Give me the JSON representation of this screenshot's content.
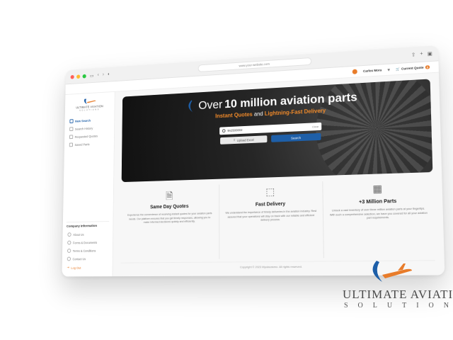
{
  "browser": {
    "url": "www.your-website.com"
  },
  "header": {
    "user_name": "Carlos Mora",
    "current_quote_label": "Current Quote",
    "quote_count": "0"
  },
  "sidebar": {
    "logo_line1": "ULTIMATE AVIATION",
    "logo_line2": "SOLUTIONS",
    "items": [
      {
        "label": "New Search",
        "icon": "search-icon",
        "active": true
      },
      {
        "label": "Search History",
        "icon": "history-icon",
        "active": false
      },
      {
        "label": "Requested Quotes",
        "icon": "quote-icon",
        "active": false
      },
      {
        "label": "Saved Parts",
        "icon": "bookmark-icon",
        "active": false
      }
    ],
    "company_title": "Company Information",
    "company_items": [
      {
        "label": "About Us",
        "icon": "info-icon"
      },
      {
        "label": "Forms & Documents",
        "icon": "document-icon"
      },
      {
        "label": "Terms & Conditions",
        "icon": "terms-icon"
      },
      {
        "label": "Contact Us",
        "icon": "phone-icon"
      }
    ],
    "logout_label": "Log Out"
  },
  "hero": {
    "title_light": "Over",
    "title_bold": "10 million aviation parts",
    "subtitle_part1": "Instant Quotes",
    "subtitle_and": "and",
    "subtitle_part2": "Lightning-Fast Delivery",
    "search_value": "9n2500002",
    "clear_label": "Clear",
    "upload_label": "Upload Excel",
    "search_button_label": "Search"
  },
  "features": [
    {
      "icon": "document-check-icon",
      "title": "Same Day Quotes",
      "text": "Experience the convenience of receiving instant quotes for your aviation parts needs. Our platform ensures that you get timely responses, allowing you to make informed decisions quickly and efficiently."
    },
    {
      "icon": "box-icon",
      "title": "Fast Delivery",
      "text": "We understand the importance of timely deliveries in the aviation industry. Rest assured that your operations will stay on track with our reliable and efficient delivery process."
    },
    {
      "icon": "boxes-icon",
      "title": "+3 Million Parts",
      "text": "Unlock a vast inventory of over three million aviation parts at your fingertips. With such a comprehensive selection, we have you covered for all your aviation part requirements."
    }
  ],
  "footer": {
    "copyright": "Copyright © 2023 Myuiacasmo. All rights reserved."
  },
  "brand": {
    "name": "ULTIMATE AVIATION",
    "sub": "SOLUTIONS"
  },
  "colors": {
    "accent": "#e87c2a",
    "primary": "#1e5fa8"
  }
}
